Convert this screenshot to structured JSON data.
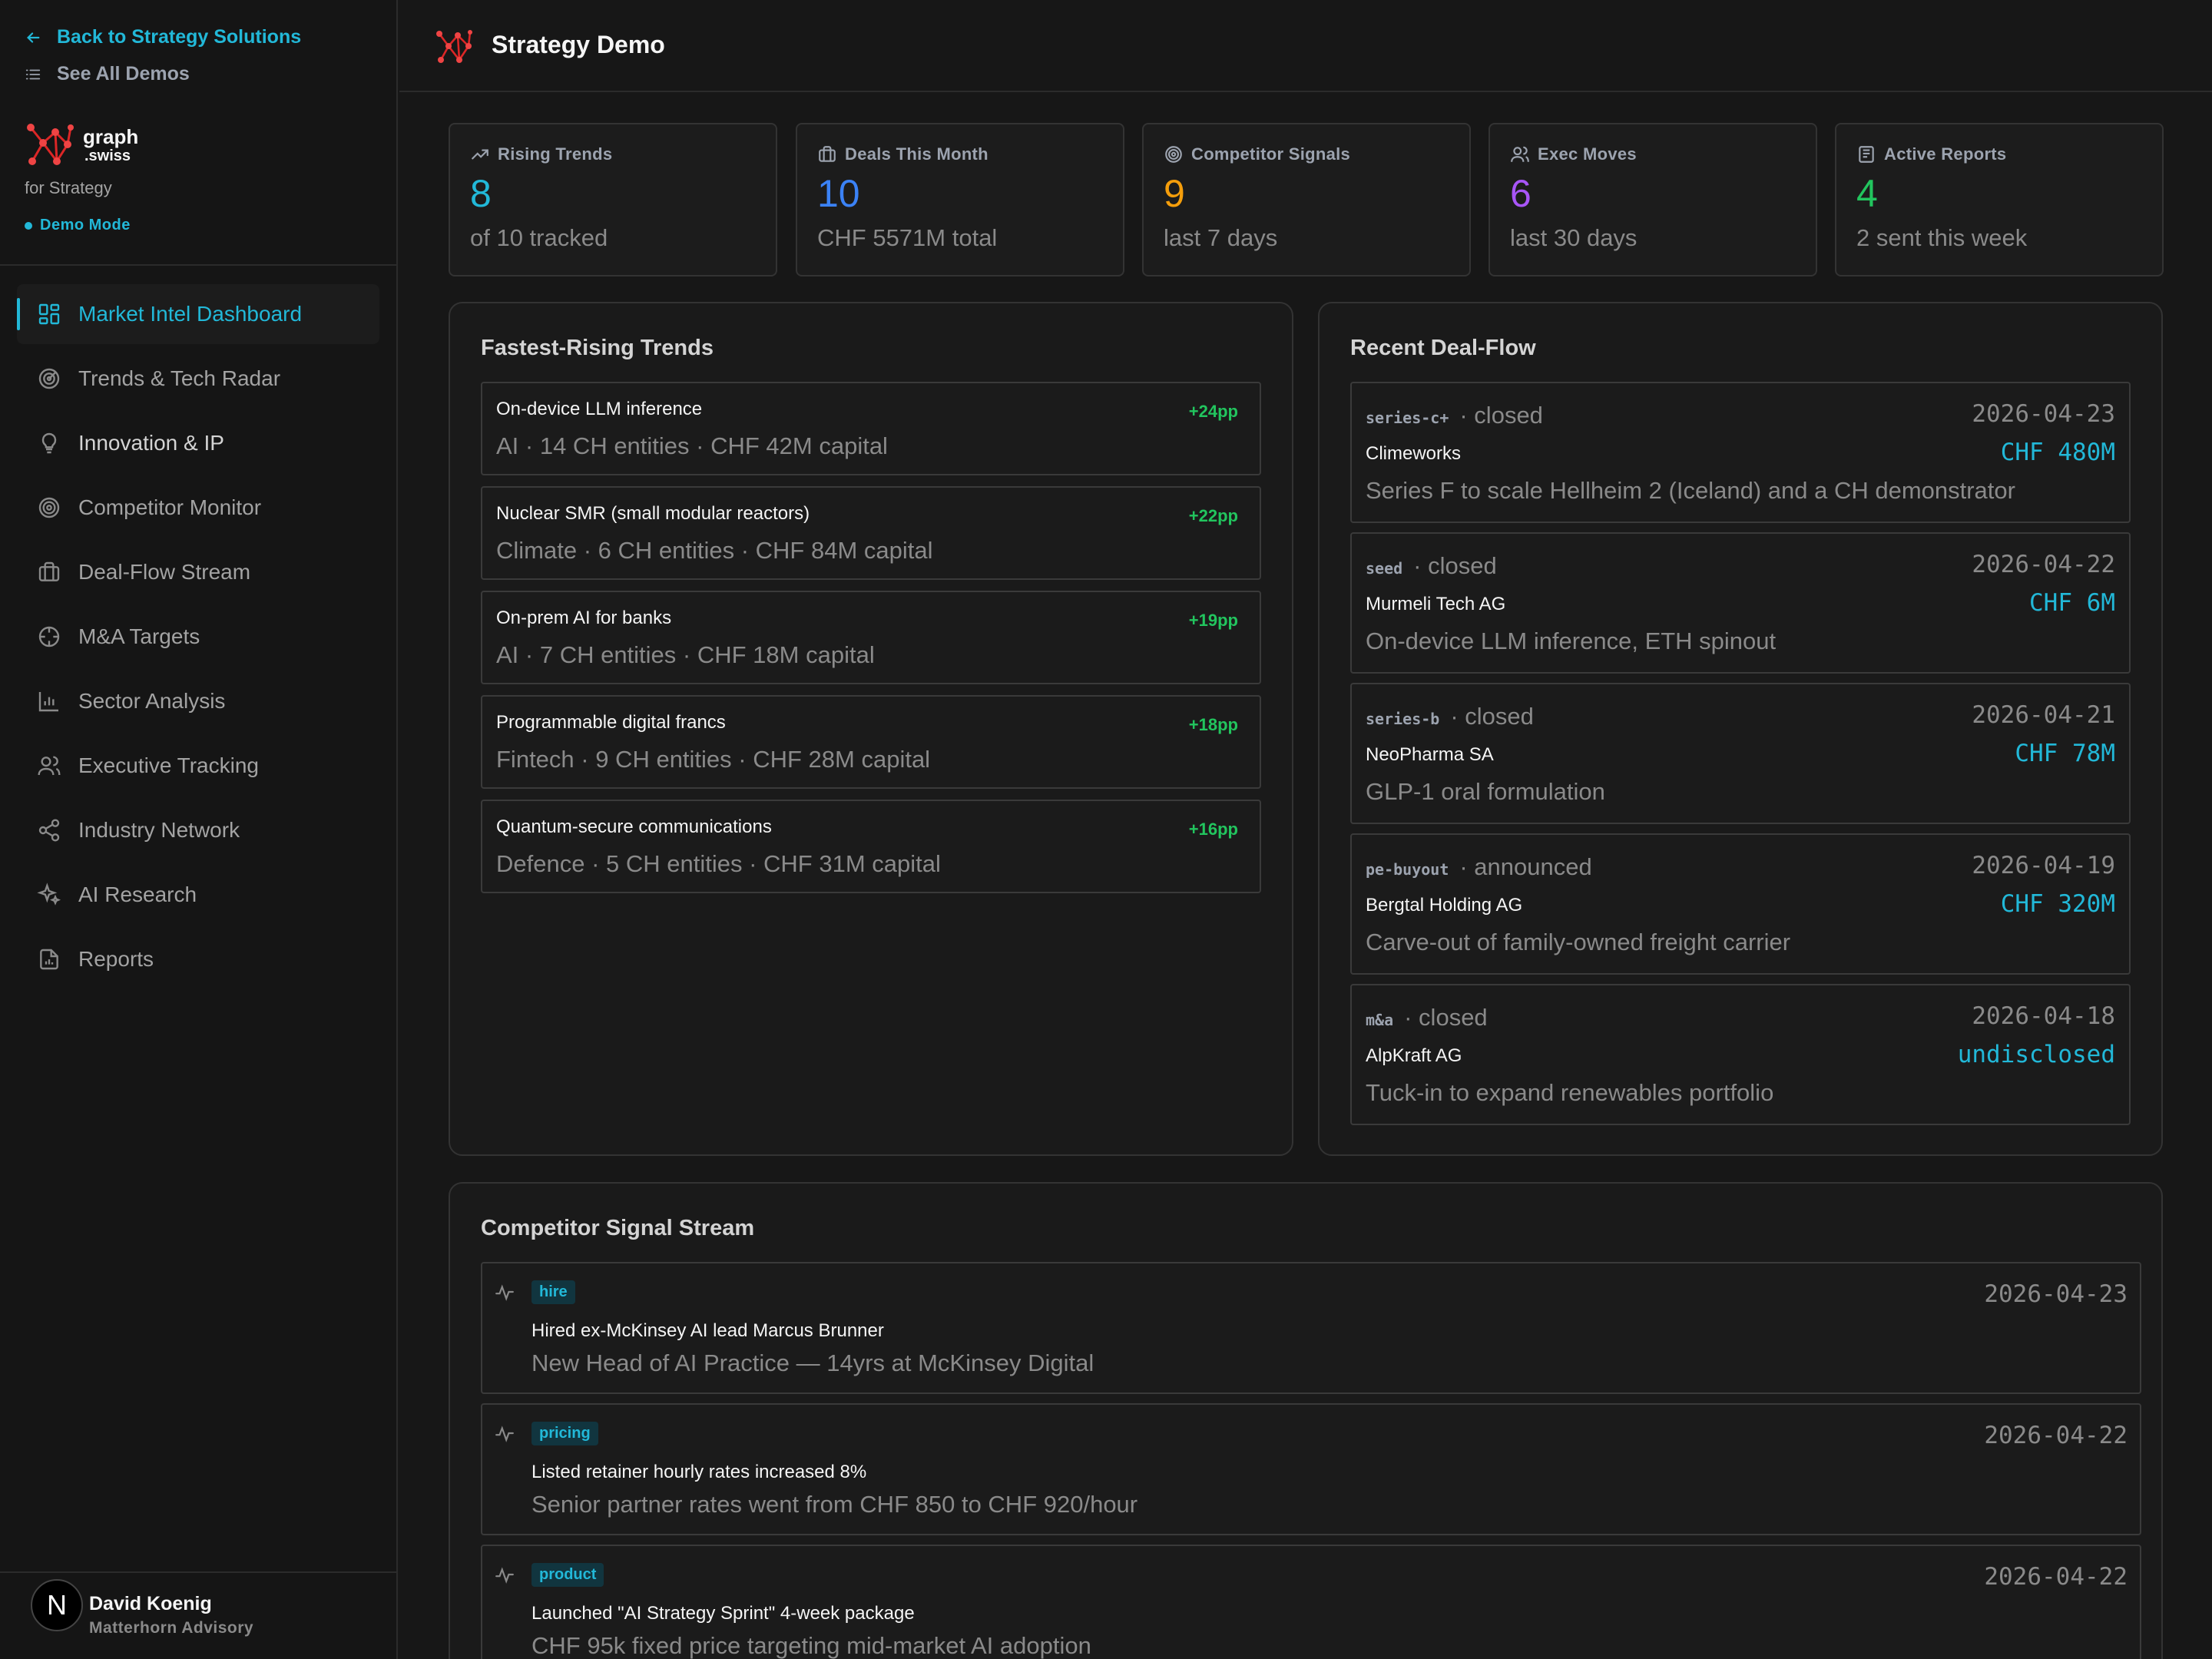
{
  "sidebar": {
    "back_label": "Back to Strategy Solutions",
    "all_demos_label": "See All Demos",
    "brand_line1": "graph",
    "brand_line2": ".swiss",
    "brand_sub": "for Strategy",
    "demo_mode": "Demo Mode",
    "items": [
      {
        "label": "Market Intel Dashboard",
        "icon": "dashboard-icon",
        "active": true
      },
      {
        "label": "Trends & Tech Radar",
        "icon": "radar-icon"
      },
      {
        "label": "Innovation & IP",
        "icon": "lightbulb-icon"
      },
      {
        "label": "Competitor Monitor",
        "icon": "target-icon"
      },
      {
        "label": "Deal-Flow Stream",
        "icon": "briefcase-icon"
      },
      {
        "label": "M&A Targets",
        "icon": "crosshair-icon"
      },
      {
        "label": "Sector Analysis",
        "icon": "bar-chart-icon"
      },
      {
        "label": "Executive Tracking",
        "icon": "users-icon"
      },
      {
        "label": "Industry Network",
        "icon": "share-icon"
      },
      {
        "label": "AI Research",
        "icon": "sparkles-icon"
      },
      {
        "label": "Reports",
        "icon": "file-chart-icon"
      }
    ],
    "user": {
      "initial": "N",
      "name": "David Koenig",
      "org": "Matterhorn Advisory"
    }
  },
  "header": {
    "title": "Strategy Demo"
  },
  "kpis": [
    {
      "label": "Rising Trends",
      "value": "8",
      "sub": "of 10 tracked",
      "color": "#22b8d8",
      "icon": "trending-up-icon"
    },
    {
      "label": "Deals This Month",
      "value": "10",
      "sub": "CHF 5571M total",
      "color": "#3b82f6",
      "icon": "briefcase-icon"
    },
    {
      "label": "Competitor Signals",
      "value": "9",
      "sub": "last 7 days",
      "color": "#f59e0b",
      "icon": "target-icon"
    },
    {
      "label": "Exec Moves",
      "value": "6",
      "sub": "last 30 days",
      "color": "#a855f7",
      "icon": "users-icon"
    },
    {
      "label": "Active Reports",
      "value": "4",
      "sub": "2 sent this week",
      "color": "#22c55e",
      "icon": "newspaper-icon"
    }
  ],
  "trends": {
    "title": "Fastest-Rising Trends",
    "items": [
      {
        "title": "On-device LLM inference",
        "delta": "+24pp",
        "meta": "AI · 14 CH entities · CHF 42M capital"
      },
      {
        "title": "Nuclear SMR (small modular reactors)",
        "delta": "+22pp",
        "meta": "Climate · 6 CH entities · CHF 84M capital"
      },
      {
        "title": "On-prem AI for banks",
        "delta": "+19pp",
        "meta": "AI · 7 CH entities · CHF 18M capital"
      },
      {
        "title": "Programmable digital francs",
        "delta": "+18pp",
        "meta": "Fintech · 9 CH entities · CHF 28M capital"
      },
      {
        "title": "Quantum-secure communications",
        "delta": "+16pp",
        "meta": "Defence · 5 CH entities · CHF 31M capital"
      }
    ]
  },
  "deals": {
    "title": "Recent Deal-Flow",
    "items": [
      {
        "stage": "series-c+",
        "status": "· closed",
        "date": "2026-04-23",
        "company": "Climeworks",
        "amount": "CHF 480M",
        "desc": "Series F to scale Hellheim 2 (Iceland) and a CH demonstrator"
      },
      {
        "stage": "seed",
        "status": "· closed",
        "date": "2026-04-22",
        "company": "Murmeli Tech AG",
        "amount": "CHF 6M",
        "desc": "On-device LLM inference, ETH spinout"
      },
      {
        "stage": "series-b",
        "status": "· closed",
        "date": "2026-04-21",
        "company": "NeoPharma SA",
        "amount": "CHF 78M",
        "desc": "GLP-1 oral formulation"
      },
      {
        "stage": "pe-buyout",
        "status": "· announced",
        "date": "2026-04-19",
        "company": "Bergtal Holding AG",
        "amount": "CHF 320M",
        "desc": "Carve-out of family-owned freight carrier"
      },
      {
        "stage": "m&a",
        "status": "· closed",
        "date": "2026-04-18",
        "company": "AlpKraft AG",
        "amount": "undisclosed",
        "desc": "Tuck-in to expand renewables portfolio"
      }
    ]
  },
  "signals": {
    "title": "Competitor Signal Stream",
    "items": [
      {
        "tag": "hire",
        "date": "2026-04-23",
        "title": "Hired ex-McKinsey AI lead Marcus Brunner",
        "desc": "New Head of AI Practice — 14yrs at McKinsey Digital"
      },
      {
        "tag": "pricing",
        "date": "2026-04-22",
        "title": "Listed retainer hourly rates increased 8%",
        "desc": "Senior partner rates went from CHF 850 to CHF 920/hour"
      },
      {
        "tag": "product",
        "date": "2026-04-22",
        "title": "Launched \"AI Strategy Sprint\" 4-week package",
        "desc": "CHF 95k fixed price targeting mid-market AI adoption"
      }
    ]
  }
}
